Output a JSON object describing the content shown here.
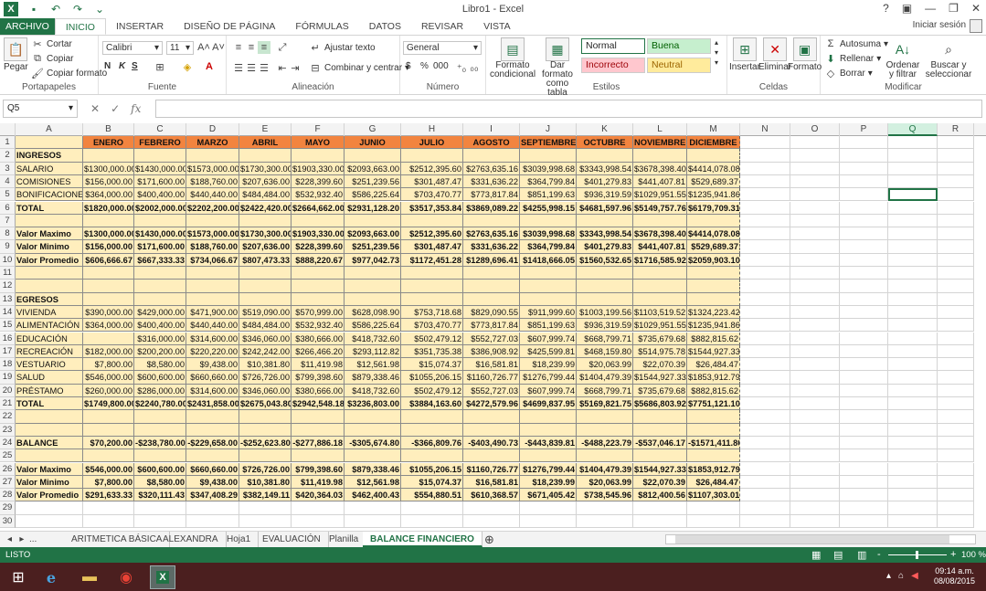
{
  "app": {
    "title": "Libro1 - Excel",
    "login": "Iniciar sesión",
    "help": "?",
    "controls": [
      "▣",
      "—",
      "❐",
      "✕"
    ]
  },
  "ribbon_tabs": [
    "ARCHIVO",
    "INICIO",
    "INSERTAR",
    "DISEÑO DE PÁGINA",
    "FÓRMULAS",
    "DATOS",
    "REVISAR",
    "VISTA"
  ],
  "ribbon": {
    "clipboard": {
      "label": "Portapapeles",
      "paste": "Pegar",
      "cut": "Cortar",
      "copy": "Copiar",
      "format_painter": "Copiar formato"
    },
    "font": {
      "label": "Fuente",
      "name": "Calibri",
      "size": "11",
      "bold": "N",
      "italic": "K",
      "underline": "S"
    },
    "alignment": {
      "label": "Alineación",
      "wrap": "Ajustar texto",
      "merge": "Combinar y centrar"
    },
    "number": {
      "label": "Número",
      "format": "General",
      "currency": "$",
      "percent": "%",
      "thousands": "000"
    },
    "styles": {
      "label": "Estilos",
      "cond_format": "Formato condicional",
      "table_format": "Dar formato como tabla",
      "normal": "Normal",
      "good": "Buena",
      "bad": "Incorrecto",
      "neutral": "Neutral"
    },
    "cells": {
      "label": "Celdas",
      "insert": "Insertar",
      "delete": "Eliminar",
      "format": "Formato"
    },
    "editing": {
      "label": "Modificar",
      "autosum": "Autosuma",
      "fill": "Rellenar",
      "clear": "Borrar",
      "sort": "Ordenar y filtrar",
      "find": "Buscar y seleccionar"
    }
  },
  "formula_bar": {
    "name_box": "Q5",
    "fx": "fx",
    "formula": ""
  },
  "columns": [
    "A",
    "B",
    "C",
    "D",
    "E",
    "F",
    "G",
    "H",
    "I",
    "J",
    "K",
    "L",
    "M",
    "N",
    "O",
    "P",
    "Q",
    "R"
  ],
  "selected_column": "Q",
  "sheet": {
    "headers": [
      "",
      "ENERO",
      "FEBRERO",
      "MARZO",
      "ABRIL",
      "MAYO",
      "JUNIO",
      "JULIO",
      "AGOSTO",
      "SEPTIEMBRE",
      "OCTUBRE",
      "NOVIEMBRE",
      "DICIEMBRE"
    ],
    "rows": [
      {
        "n": "2",
        "b": true,
        "cells": [
          "INGRESOS",
          "",
          "",
          "",
          "",
          "",
          "",
          "",
          "",
          "",
          "",
          "",
          ""
        ]
      },
      {
        "n": "3",
        "cells": [
          "SALARIO",
          "$1300,000.00",
          "$1430,000.00",
          "$1573,000.00",
          "$1730,300.00",
          "$1903,330.00",
          "$2093,663.00",
          "$2512,395.60",
          "$2763,635.16",
          "$3039,998.68",
          "$3343,998.54",
          "$3678,398.40",
          "$4414,078.08"
        ]
      },
      {
        "n": "4",
        "cells": [
          "COMISIONES",
          "$156,000.00",
          "$171,600.00",
          "$188,760.00",
          "$207,636.00",
          "$228,399.60",
          "$251,239.56",
          "$301,487.47",
          "$331,636.22",
          "$364,799.84",
          "$401,279.83",
          "$441,407.81",
          "$529,689.37"
        ]
      },
      {
        "n": "5",
        "cells": [
          "BONIFICACIONES",
          "$364,000.00",
          "$400,400.00",
          "$440,440.00",
          "$484,484.00",
          "$532,932.40",
          "$586,225.64",
          "$703,470.77",
          "$773,817.84",
          "$851,199.63",
          "$936,319.59",
          "$1029,951.55",
          "$1235,941.86"
        ]
      },
      {
        "n": "6",
        "b": true,
        "cells": [
          "TOTAL",
          "$1820,000.00",
          "$2002,000.00",
          "$2202,200.00",
          "$2422,420.00",
          "$2664,662.00",
          "$2931,128.20",
          "$3517,353.84",
          "$3869,089.22",
          "$4255,998.15",
          "$4681,597.96",
          "$5149,757.76",
          "$6179,709.31"
        ]
      },
      {
        "n": "7",
        "cells": [
          "",
          "",
          "",
          "",
          "",
          "",
          "",
          "",
          "",
          "",
          "",
          "",
          ""
        ]
      },
      {
        "n": "8",
        "b": true,
        "cells": [
          "Valor Maximo",
          "$1300,000.00",
          "$1430,000.00",
          "$1573,000.00",
          "$1730,300.00",
          "$1903,330.00",
          "$2093,663.00",
          "$2512,395.60",
          "$2763,635.16",
          "$3039,998.68",
          "$3343,998.54",
          "$3678,398.40",
          "$4414,078.08"
        ]
      },
      {
        "n": "9",
        "b": true,
        "cells": [
          "Valor Minimo",
          "$156,000.00",
          "$171,600.00",
          "$188,760.00",
          "$207,636.00",
          "$228,399.60",
          "$251,239.56",
          "$301,487.47",
          "$331,636.22",
          "$364,799.84",
          "$401,279.83",
          "$441,407.81",
          "$529,689.37"
        ]
      },
      {
        "n": "10",
        "b": true,
        "cells": [
          "Valor Promedio",
          "$606,666.67",
          "$667,333.33",
          "$734,066.67",
          "$807,473.33",
          "$888,220.67",
          "$977,042.73",
          "$1172,451.28",
          "$1289,696.41",
          "$1418,666.05",
          "$1560,532.65",
          "$1716,585.92",
          "$2059,903.10"
        ]
      },
      {
        "n": "11",
        "cells": [
          "",
          "",
          "",
          "",
          "",
          "",
          "",
          "",
          "",
          "",
          "",
          "",
          ""
        ]
      },
      {
        "n": "12",
        "cells": [
          "",
          "",
          "",
          "",
          "",
          "",
          "",
          "",
          "",
          "",
          "",
          "",
          ""
        ]
      },
      {
        "n": "13",
        "b": true,
        "cells": [
          "EGRESOS",
          "",
          "",
          "",
          "",
          "",
          "",
          "",
          "",
          "",
          "",
          "",
          ""
        ]
      },
      {
        "n": "14",
        "cells": [
          "VIVIENDA",
          "$390,000.00",
          "$429,000.00",
          "$471,900.00",
          "$519,090.00",
          "$570,999.00",
          "$628,098.90",
          "$753,718.68",
          "$829,090.55",
          "$911,999.60",
          "$1003,199.56",
          "$1103,519.52",
          "$1324,223.42"
        ]
      },
      {
        "n": "15",
        "cells": [
          "ALIMENTACIÓN",
          "$364,000.00",
          "$400,400.00",
          "$440,440.00",
          "$484,484.00",
          "$532,932.40",
          "$586,225.64",
          "$703,470.77",
          "$773,817.84",
          "$851,199.63",
          "$936,319.59",
          "$1029,951.55",
          "$1235,941.86"
        ]
      },
      {
        "n": "16",
        "cells": [
          "EDUCACIÓN",
          "",
          "$316,000.00",
          "$314,600.00",
          "$346,060.00",
          "$380,666.00",
          "$418,732.60",
          "$502,479.12",
          "$552,727.03",
          "$607,999.74",
          "$668,799.71",
          "$735,679.68",
          "$882,815.62"
        ]
      },
      {
        "n": "17",
        "cells": [
          "RECREACIÓN",
          "$182,000.00",
          "$200,200.00",
          "$220,220.00",
          "$242,242.00",
          "$266,466.20",
          "$293,112.82",
          "$351,735.38",
          "$386,908.92",
          "$425,599.81",
          "$468,159.80",
          "$514,975.78",
          "$1544,927.33"
        ]
      },
      {
        "n": "18",
        "cells": [
          "VESTUARIO",
          "$7,800.00",
          "$8,580.00",
          "$9,438.00",
          "$10,381.80",
          "$11,419.98",
          "$12,561.98",
          "$15,074.37",
          "$16,581.81",
          "$18,239.99",
          "$20,063.99",
          "$22,070.39",
          "$26,484.47"
        ]
      },
      {
        "n": "19",
        "cells": [
          "SALUD",
          "$546,000.00",
          "$600,600.00",
          "$660,660.00",
          "$726,726.00",
          "$799,398.60",
          "$879,338.46",
          "$1055,206.15",
          "$1160,726.77",
          "$1276,799.44",
          "$1404,479.39",
          "$1544,927.33",
          "$1853,912.79"
        ]
      },
      {
        "n": "20",
        "cells": [
          "PRÉSTAMO",
          "$260,000.00",
          "$286,000.00",
          "$314,600.00",
          "$346,060.00",
          "$380,666.00",
          "$418,732.60",
          "$502,479.12",
          "$552,727.03",
          "$607,999.74",
          "$668,799.71",
          "$735,679.68",
          "$882,815.62"
        ]
      },
      {
        "n": "21",
        "b": true,
        "cells": [
          "TOTAL",
          "$1749,800.00",
          "$2240,780.00",
          "$2431,858.00",
          "$2675,043.80",
          "$2942,548.18",
          "$3236,803.00",
          "$3884,163.60",
          "$4272,579.96",
          "$4699,837.95",
          "$5169,821.75",
          "$5686,803.92",
          "$7751,121.10"
        ]
      },
      {
        "n": "22",
        "cells": [
          "",
          "",
          "",
          "",
          "",
          "",
          "",
          "",
          "",
          "",
          "",
          "",
          ""
        ]
      },
      {
        "n": "23",
        "cells": [
          "",
          "",
          "",
          "",
          "",
          "",
          "",
          "",
          "",
          "",
          "",
          "",
          ""
        ]
      },
      {
        "n": "24",
        "b": true,
        "cells": [
          "BALANCE",
          "$70,200.00",
          "-$238,780.00",
          "-$229,658.00",
          "-$252,623.80",
          "-$277,886.18",
          "-$305,674.80",
          "-$366,809.76",
          "-$403,490.73",
          "-$443,839.81",
          "-$488,223.79",
          "-$537,046.17",
          "-$1571,411.80"
        ]
      },
      {
        "n": "25",
        "cells": [
          "",
          "",
          "",
          "",
          "",
          "",
          "",
          "",
          "",
          "",
          "",
          "",
          ""
        ]
      },
      {
        "n": "26",
        "b": true,
        "cells": [
          "Valor Maximo",
          "$546,000.00",
          "$600,600.00",
          "$660,660.00",
          "$726,726.00",
          "$799,398.60",
          "$879,338.46",
          "$1055,206.15",
          "$1160,726.77",
          "$1276,799.44",
          "$1404,479.39",
          "$1544,927.33",
          "$1853,912.79"
        ]
      },
      {
        "n": "27",
        "b": true,
        "cells": [
          "Valor Minimo",
          "$7,800.00",
          "$8,580.00",
          "$9,438.00",
          "$10,381.80",
          "$11,419.98",
          "$12,561.98",
          "$15,074.37",
          "$16,581.81",
          "$18,239.99",
          "$20,063.99",
          "$22,070.39",
          "$26,484.47"
        ]
      },
      {
        "n": "28",
        "b": true,
        "cells": [
          "Valor Promedio",
          "$291,633.33",
          "$320,111.43",
          "$347,408.29",
          "$382,149.11",
          "$420,364.03",
          "$462,400.43",
          "$554,880.51",
          "$610,368.57",
          "$671,405.42",
          "$738,545.96",
          "$812,400.56",
          "$1107,303.01"
        ]
      }
    ],
    "empty_rows": [
      "29",
      "30"
    ]
  },
  "sheet_tabs": [
    "ARITMETICA BÁSICA",
    "ALEXANDRA",
    "Hoja1",
    "EVALUACIÓN",
    "Planilla",
    "BALANCE FINANCIERO"
  ],
  "active_sheet": "BALANCE FINANCIERO",
  "status": {
    "mode": "LISTO",
    "zoom": "100 %",
    "zoom_minus": "-",
    "zoom_plus": "+"
  },
  "taskbar": {
    "time": "09:14 a.m.",
    "date": "08/08/2015"
  },
  "colors": {
    "accent": "#217346",
    "header_fill": "#f2843f",
    "data_fill": "#ffeebd",
    "taskbar": "#4b1f1f"
  }
}
